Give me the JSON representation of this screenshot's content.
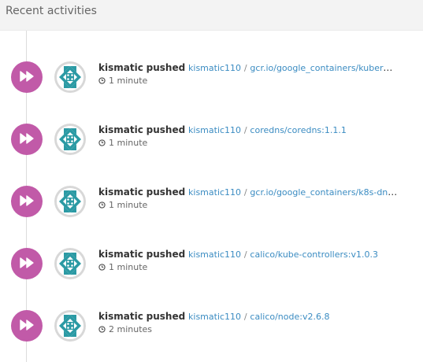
{
  "header": {
    "title": "Recent activities"
  },
  "colors": {
    "badge": "#c15aa8",
    "link": "#3b8cc2",
    "avatar_teal": "#2b9aa4"
  },
  "icons": {
    "badge": "fast-forward-icon",
    "time": "clock-icon"
  },
  "activities": [
    {
      "actor": "kismatic",
      "verb": "pushed",
      "namespace": "kismatic110",
      "separator": "/",
      "repository": "gcr.io/google_containers/kubernet…",
      "time": "1 minute"
    },
    {
      "actor": "kismatic",
      "verb": "pushed",
      "namespace": "kismatic110",
      "separator": "/",
      "repository": "coredns/coredns:1.1.1",
      "time": "1 minute"
    },
    {
      "actor": "kismatic",
      "verb": "pushed",
      "namespace": "kismatic110",
      "separator": "/",
      "repository": "gcr.io/google_containers/k8s-dns-…",
      "time": "1 minute"
    },
    {
      "actor": "kismatic",
      "verb": "pushed",
      "namespace": "kismatic110",
      "separator": "/",
      "repository": "calico/kube-controllers:v1.0.3",
      "time": "1 minute"
    },
    {
      "actor": "kismatic",
      "verb": "pushed",
      "namespace": "kismatic110",
      "separator": "/",
      "repository": "calico/node:v2.6.8",
      "time": "2 minutes"
    }
  ]
}
